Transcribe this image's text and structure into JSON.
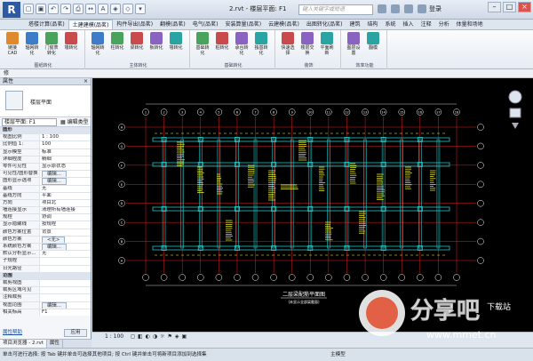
{
  "window": {
    "title": "2.rvt - 楼层平面: F1",
    "search_placeholder": "键入关键字或短语",
    "user": "登录"
  },
  "tabs": [
    "塔楼计算(品茗)",
    "土建建模(品茗)",
    "构件导出(品茗)",
    "翻模(品茗)",
    "电气(品茗)",
    "安装算量(品茗)",
    "云建模(品茗)",
    "出图转化(品茗)",
    "建筑",
    "结构",
    "系统",
    "插入",
    "注释",
    "分析",
    "体量和场地"
  ],
  "active_tab_index": 1,
  "ribbon": {
    "groups": [
      {
        "label": "图纸转化",
        "buttons": [
          "链接CAD",
          "轴网转化",
          "门窗表转化",
          "墙转化"
        ]
      },
      {
        "label": "主体转化",
        "buttons": [
          "轴网转化",
          "柱转化",
          "梁转化",
          "板转化",
          "墙转化"
        ]
      },
      {
        "label": "基础转化",
        "buttons": [
          "基础转化",
          "桩转化",
          "承台转化",
          "独基转化"
        ]
      },
      {
        "label": "装饰",
        "buttons": [
          "快速选择",
          "楼层交换",
          "平面刷新"
        ]
      },
      {
        "label": "效率功能",
        "buttons": [
          "图层设置",
          "翻模"
        ]
      }
    ]
  },
  "selector_label": "修",
  "properties": {
    "header": "属性",
    "type_name": "楼层平面",
    "filter_value": "楼层平面: F1",
    "edit_type_label": "编辑类型",
    "rows": [
      {
        "name": "图形",
        "value": "",
        "cat": true
      },
      {
        "name": "视图比例",
        "value": "1 : 100"
      },
      {
        "name": "比例值 1:",
        "value": "100"
      },
      {
        "name": "显示模型",
        "value": "标准"
      },
      {
        "name": "详细程度",
        "value": "精细"
      },
      {
        "name": "零件可见性",
        "value": "显示原状态"
      },
      {
        "name": "可见性/图形替换",
        "value": "编辑...",
        "btn": true
      },
      {
        "name": "图形显示选项",
        "value": "编辑...",
        "btn": true
      },
      {
        "name": "基线",
        "value": "无"
      },
      {
        "name": "基线方向",
        "value": "平面"
      },
      {
        "name": "方向",
        "value": "项目北"
      },
      {
        "name": "墙连接显示",
        "value": "清理所有墙连接"
      },
      {
        "name": "规程",
        "value": "协调"
      },
      {
        "name": "显示隐藏线",
        "value": "按规程"
      },
      {
        "name": "颜色方案位置",
        "value": "背景"
      },
      {
        "name": "颜色方案",
        "value": "<无>",
        "btn": true
      },
      {
        "name": "系统颜色方案",
        "value": "编辑...",
        "btn": true
      },
      {
        "name": "默认分析显示...",
        "value": "无"
      },
      {
        "name": "子规程",
        "value": ""
      },
      {
        "name": "日光路径",
        "value": ""
      },
      {
        "name": "范围",
        "value": "",
        "cat": true
      },
      {
        "name": "裁剪视图",
        "value": ""
      },
      {
        "name": "裁剪区域可见",
        "value": ""
      },
      {
        "name": "注释裁剪",
        "value": ""
      },
      {
        "name": "视图范围",
        "value": "编辑...",
        "btn": true
      },
      {
        "name": "相关标高",
        "value": "F1"
      }
    ],
    "help_link": "属性帮助",
    "apply_label": "应用",
    "bottom_tabs": [
      "项目浏览器 - 2.rvt",
      "属性"
    ]
  },
  "drawing": {
    "title": "二层梁配筋平面图",
    "subtitle": "(未显示全部梁截面)",
    "axis_top": [
      "1",
      "2",
      "3",
      "4",
      "5",
      "6",
      "7",
      "8",
      "9",
      "10",
      "11",
      "12",
      "13",
      "14",
      "15",
      "16",
      "17",
      "18"
    ],
    "axis_left": [
      "H",
      "G",
      "F",
      "E",
      "D",
      "C",
      "B",
      "A"
    ],
    "colors": {
      "background": "#000000",
      "grid": "#e02020",
      "wall": "#21c6c6",
      "rebar": "#ffff33",
      "text": "#ffffff"
    }
  },
  "view_control": {
    "scale": "1 : 100"
  },
  "status": {
    "text": "单击可进行选择; 按 Tab 键并单击可选择其他项目; 按 Ctrl 键并单击可将新项目添加到选择集",
    "model_label": "主模型"
  },
  "watermark": {
    "brand": "分享吧",
    "sub": "下载站",
    "url": "www.mmet.cn"
  }
}
